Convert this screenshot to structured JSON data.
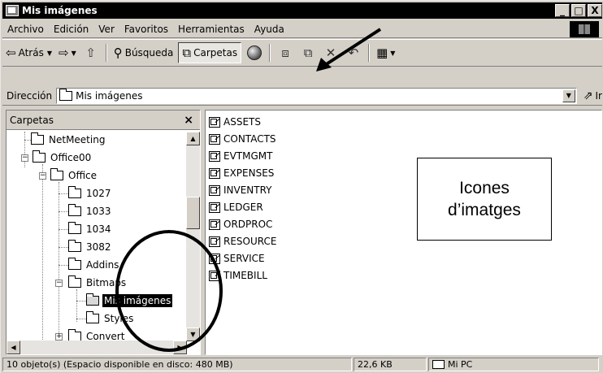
{
  "window": {
    "title": "Mis imágenes",
    "buttons": {
      "minimize": "_",
      "maximize": "□",
      "close": "X"
    }
  },
  "menu": {
    "items": [
      "Archivo",
      "Edición",
      "Ver",
      "Favoritos",
      "Herramientas",
      "Ayuda"
    ]
  },
  "toolbar": {
    "back_label": "Atrás",
    "search_label": "Búsqueda",
    "folders_label": "Carpetas"
  },
  "address": {
    "label": "Dirección",
    "value": "Mis imágenes",
    "go_label": "Ir"
  },
  "folders_pane": {
    "title": "Carpetas",
    "close": "×",
    "tree": [
      {
        "label": "NetMeeting",
        "level": 2,
        "expander": ""
      },
      {
        "label": "Office00",
        "level": 1,
        "expander": "−"
      },
      {
        "label": "Office",
        "level": 2,
        "expander": "−"
      },
      {
        "label": "1027",
        "level": 3,
        "expander": ""
      },
      {
        "label": "1033",
        "level": 3,
        "expander": ""
      },
      {
        "label": "1034",
        "level": 3,
        "expander": ""
      },
      {
        "label": "3082",
        "level": 3,
        "expander": ""
      },
      {
        "label": "Addins",
        "level": 3,
        "expander": ""
      },
      {
        "label": "Bitmaps",
        "level": 3,
        "expander": "−"
      },
      {
        "label": "Mis imágenes",
        "level": 4,
        "expander": "",
        "selected": true
      },
      {
        "label": "Styles",
        "level": 4,
        "expander": ""
      },
      {
        "label": "Convert",
        "level": 3,
        "expander": "+"
      }
    ]
  },
  "files": [
    "ASSETS",
    "CONTACTS",
    "EVTMGMT",
    "EXPENSES",
    "INVENTRY",
    "LEDGER",
    "ORDPROC",
    "RESOURCE",
    "SERVICE",
    "TIMEBILL"
  ],
  "callout": {
    "line1": "Icones",
    "line2": "d’imatges"
  },
  "status": {
    "objects": "10 objeto(s) (Espacio disponible en disco: 480 MB)",
    "size": "22,6 KB",
    "location": "Mi PC"
  },
  "colors": {
    "titlebar": "#000000",
    "chrome": "#d4d0c8",
    "selection": "#000000"
  }
}
